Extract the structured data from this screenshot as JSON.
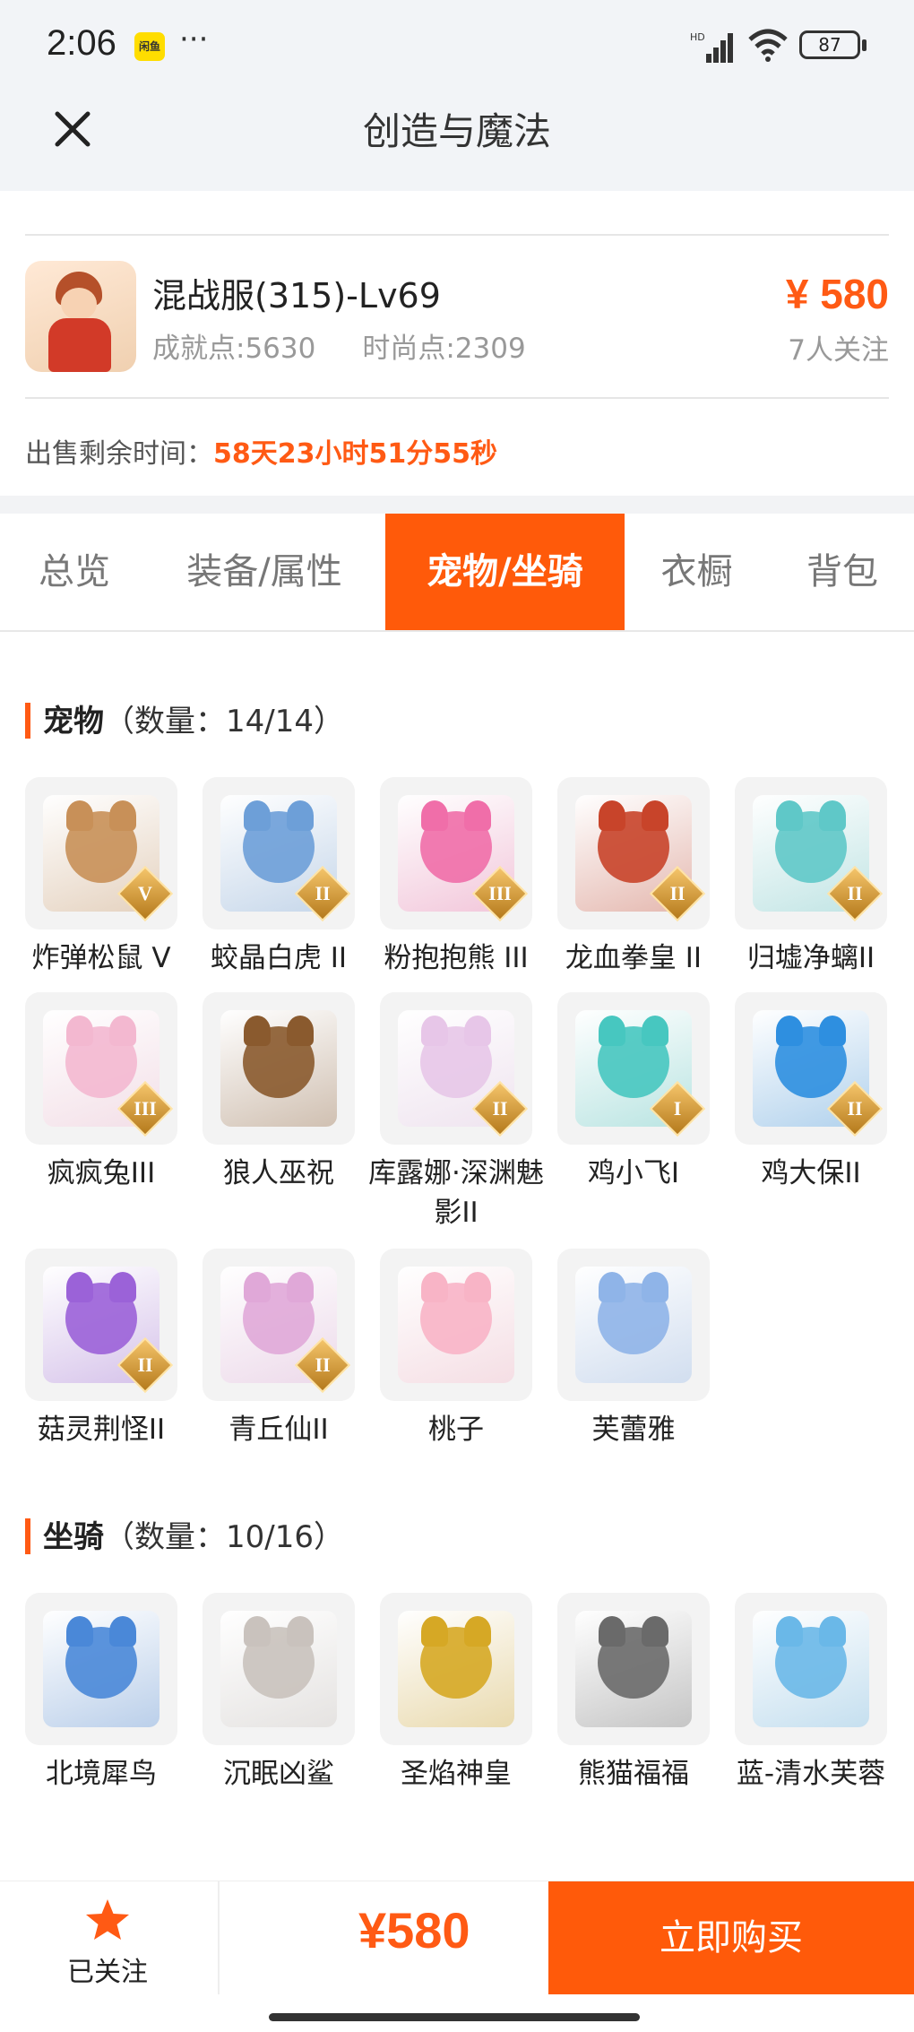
{
  "status_bar": {
    "time": "2:06",
    "app_badge": "闲鱼",
    "more": "···",
    "network": "HD",
    "battery": "87"
  },
  "nav": {
    "close_icon": "close-icon",
    "title": "创造与魔法"
  },
  "listing": {
    "server": "混战服(315)-Lv69",
    "achievement": "成就点:5630",
    "fashion": "时尚点:2309",
    "price": "¥ 580",
    "followers": "7人关注",
    "remain_label": "出售剩余时间：",
    "remain_value": "58天23小时51分55秒"
  },
  "tabs": [
    {
      "label": "总览",
      "active": false
    },
    {
      "label": "装备/属性",
      "active": false
    },
    {
      "label": "宠物/坐骑",
      "active": true
    },
    {
      "label": "衣橱",
      "active": false
    },
    {
      "label": "背包",
      "active": false
    }
  ],
  "pets": {
    "title": "宠物",
    "count": "（数量：14/14）",
    "items": [
      {
        "name": "炸弹松鼠 V",
        "rank": "V",
        "color": "#c89058"
      },
      {
        "name": "蛟晶白虎 II",
        "rank": "II",
        "color": "#6d9fd8"
      },
      {
        "name": "粉抱抱熊 III",
        "rank": "III",
        "color": "#f06ea9"
      },
      {
        "name": "龙血拳皇 II",
        "rank": "II",
        "color": "#c8442a"
      },
      {
        "name": "归墟净螭II",
        "rank": "II",
        "color": "#5fc8c8"
      },
      {
        "name": "疯疯兔III",
        "rank": "III",
        "color": "#f3b8d0"
      },
      {
        "name": "狼人巫祝",
        "rank": "",
        "color": "#8a5a2e"
      },
      {
        "name": "库露娜·深渊魅影II",
        "rank": "II",
        "color": "#e7c6e8"
      },
      {
        "name": "鸡小飞I",
        "rank": "I",
        "color": "#47c7c0"
      },
      {
        "name": "鸡大保II",
        "rank": "II",
        "color": "#2e8fe0"
      },
      {
        "name": "菇灵荆怪II",
        "rank": "II",
        "color": "#9b62d8"
      },
      {
        "name": "青丘仙II",
        "rank": "II",
        "color": "#e0a8d8"
      },
      {
        "name": "桃子",
        "rank": "",
        "color": "#f8b4c6"
      },
      {
        "name": "芙蕾雅",
        "rank": "",
        "color": "#8fb4e8"
      }
    ]
  },
  "mounts": {
    "title": "坐骑",
    "count": "（数量：10/16）",
    "items": [
      {
        "name": "北境犀鸟",
        "color": "#4a88d8"
      },
      {
        "name": "沉眠凶鲨",
        "color": "#c9c2bd"
      },
      {
        "name": "圣焰神皇",
        "color": "#d6a825"
      },
      {
        "name": "熊猫福福",
        "color": "#6a6a6a"
      },
      {
        "name": "蓝-清水芙蓉",
        "color": "#6ab8e8"
      }
    ]
  },
  "bottom_bar": {
    "follow_label": "已关注",
    "price": "¥580",
    "buy_label": "立即购买"
  }
}
